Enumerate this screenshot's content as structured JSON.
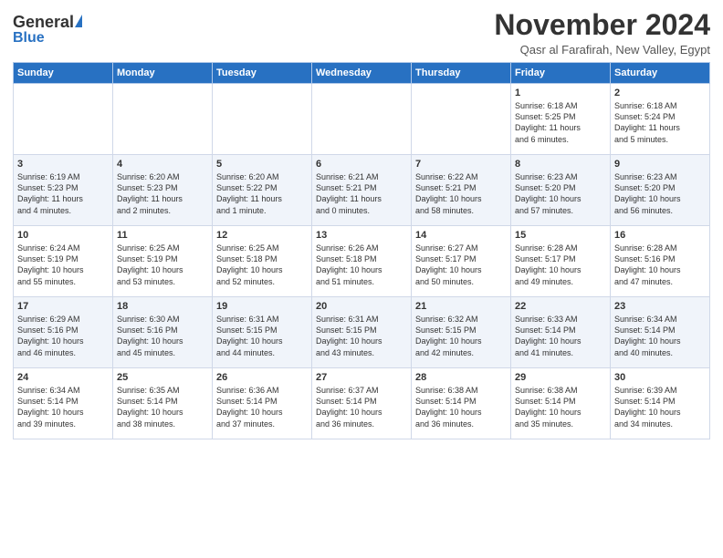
{
  "header": {
    "logo_general": "General",
    "logo_blue": "Blue",
    "month_title": "November 2024",
    "location": "Qasr al Farafirah, New Valley, Egypt"
  },
  "days_of_week": [
    "Sunday",
    "Monday",
    "Tuesday",
    "Wednesday",
    "Thursday",
    "Friday",
    "Saturday"
  ],
  "weeks": [
    [
      {
        "day": "",
        "info": ""
      },
      {
        "day": "",
        "info": ""
      },
      {
        "day": "",
        "info": ""
      },
      {
        "day": "",
        "info": ""
      },
      {
        "day": "",
        "info": ""
      },
      {
        "day": "1",
        "info": "Sunrise: 6:18 AM\nSunset: 5:25 PM\nDaylight: 11 hours\nand 6 minutes."
      },
      {
        "day": "2",
        "info": "Sunrise: 6:18 AM\nSunset: 5:24 PM\nDaylight: 11 hours\nand 5 minutes."
      }
    ],
    [
      {
        "day": "3",
        "info": "Sunrise: 6:19 AM\nSunset: 5:23 PM\nDaylight: 11 hours\nand 4 minutes."
      },
      {
        "day": "4",
        "info": "Sunrise: 6:20 AM\nSunset: 5:23 PM\nDaylight: 11 hours\nand 2 minutes."
      },
      {
        "day": "5",
        "info": "Sunrise: 6:20 AM\nSunset: 5:22 PM\nDaylight: 11 hours\nand 1 minute."
      },
      {
        "day": "6",
        "info": "Sunrise: 6:21 AM\nSunset: 5:21 PM\nDaylight: 11 hours\nand 0 minutes."
      },
      {
        "day": "7",
        "info": "Sunrise: 6:22 AM\nSunset: 5:21 PM\nDaylight: 10 hours\nand 58 minutes."
      },
      {
        "day": "8",
        "info": "Sunrise: 6:23 AM\nSunset: 5:20 PM\nDaylight: 10 hours\nand 57 minutes."
      },
      {
        "day": "9",
        "info": "Sunrise: 6:23 AM\nSunset: 5:20 PM\nDaylight: 10 hours\nand 56 minutes."
      }
    ],
    [
      {
        "day": "10",
        "info": "Sunrise: 6:24 AM\nSunset: 5:19 PM\nDaylight: 10 hours\nand 55 minutes."
      },
      {
        "day": "11",
        "info": "Sunrise: 6:25 AM\nSunset: 5:19 PM\nDaylight: 10 hours\nand 53 minutes."
      },
      {
        "day": "12",
        "info": "Sunrise: 6:25 AM\nSunset: 5:18 PM\nDaylight: 10 hours\nand 52 minutes."
      },
      {
        "day": "13",
        "info": "Sunrise: 6:26 AM\nSunset: 5:18 PM\nDaylight: 10 hours\nand 51 minutes."
      },
      {
        "day": "14",
        "info": "Sunrise: 6:27 AM\nSunset: 5:17 PM\nDaylight: 10 hours\nand 50 minutes."
      },
      {
        "day": "15",
        "info": "Sunrise: 6:28 AM\nSunset: 5:17 PM\nDaylight: 10 hours\nand 49 minutes."
      },
      {
        "day": "16",
        "info": "Sunrise: 6:28 AM\nSunset: 5:16 PM\nDaylight: 10 hours\nand 47 minutes."
      }
    ],
    [
      {
        "day": "17",
        "info": "Sunrise: 6:29 AM\nSunset: 5:16 PM\nDaylight: 10 hours\nand 46 minutes."
      },
      {
        "day": "18",
        "info": "Sunrise: 6:30 AM\nSunset: 5:16 PM\nDaylight: 10 hours\nand 45 minutes."
      },
      {
        "day": "19",
        "info": "Sunrise: 6:31 AM\nSunset: 5:15 PM\nDaylight: 10 hours\nand 44 minutes."
      },
      {
        "day": "20",
        "info": "Sunrise: 6:31 AM\nSunset: 5:15 PM\nDaylight: 10 hours\nand 43 minutes."
      },
      {
        "day": "21",
        "info": "Sunrise: 6:32 AM\nSunset: 5:15 PM\nDaylight: 10 hours\nand 42 minutes."
      },
      {
        "day": "22",
        "info": "Sunrise: 6:33 AM\nSunset: 5:14 PM\nDaylight: 10 hours\nand 41 minutes."
      },
      {
        "day": "23",
        "info": "Sunrise: 6:34 AM\nSunset: 5:14 PM\nDaylight: 10 hours\nand 40 minutes."
      }
    ],
    [
      {
        "day": "24",
        "info": "Sunrise: 6:34 AM\nSunset: 5:14 PM\nDaylight: 10 hours\nand 39 minutes."
      },
      {
        "day": "25",
        "info": "Sunrise: 6:35 AM\nSunset: 5:14 PM\nDaylight: 10 hours\nand 38 minutes."
      },
      {
        "day": "26",
        "info": "Sunrise: 6:36 AM\nSunset: 5:14 PM\nDaylight: 10 hours\nand 37 minutes."
      },
      {
        "day": "27",
        "info": "Sunrise: 6:37 AM\nSunset: 5:14 PM\nDaylight: 10 hours\nand 36 minutes."
      },
      {
        "day": "28",
        "info": "Sunrise: 6:38 AM\nSunset: 5:14 PM\nDaylight: 10 hours\nand 36 minutes."
      },
      {
        "day": "29",
        "info": "Sunrise: 6:38 AM\nSunset: 5:14 PM\nDaylight: 10 hours\nand 35 minutes."
      },
      {
        "day": "30",
        "info": "Sunrise: 6:39 AM\nSunset: 5:14 PM\nDaylight: 10 hours\nand 34 minutes."
      }
    ]
  ]
}
